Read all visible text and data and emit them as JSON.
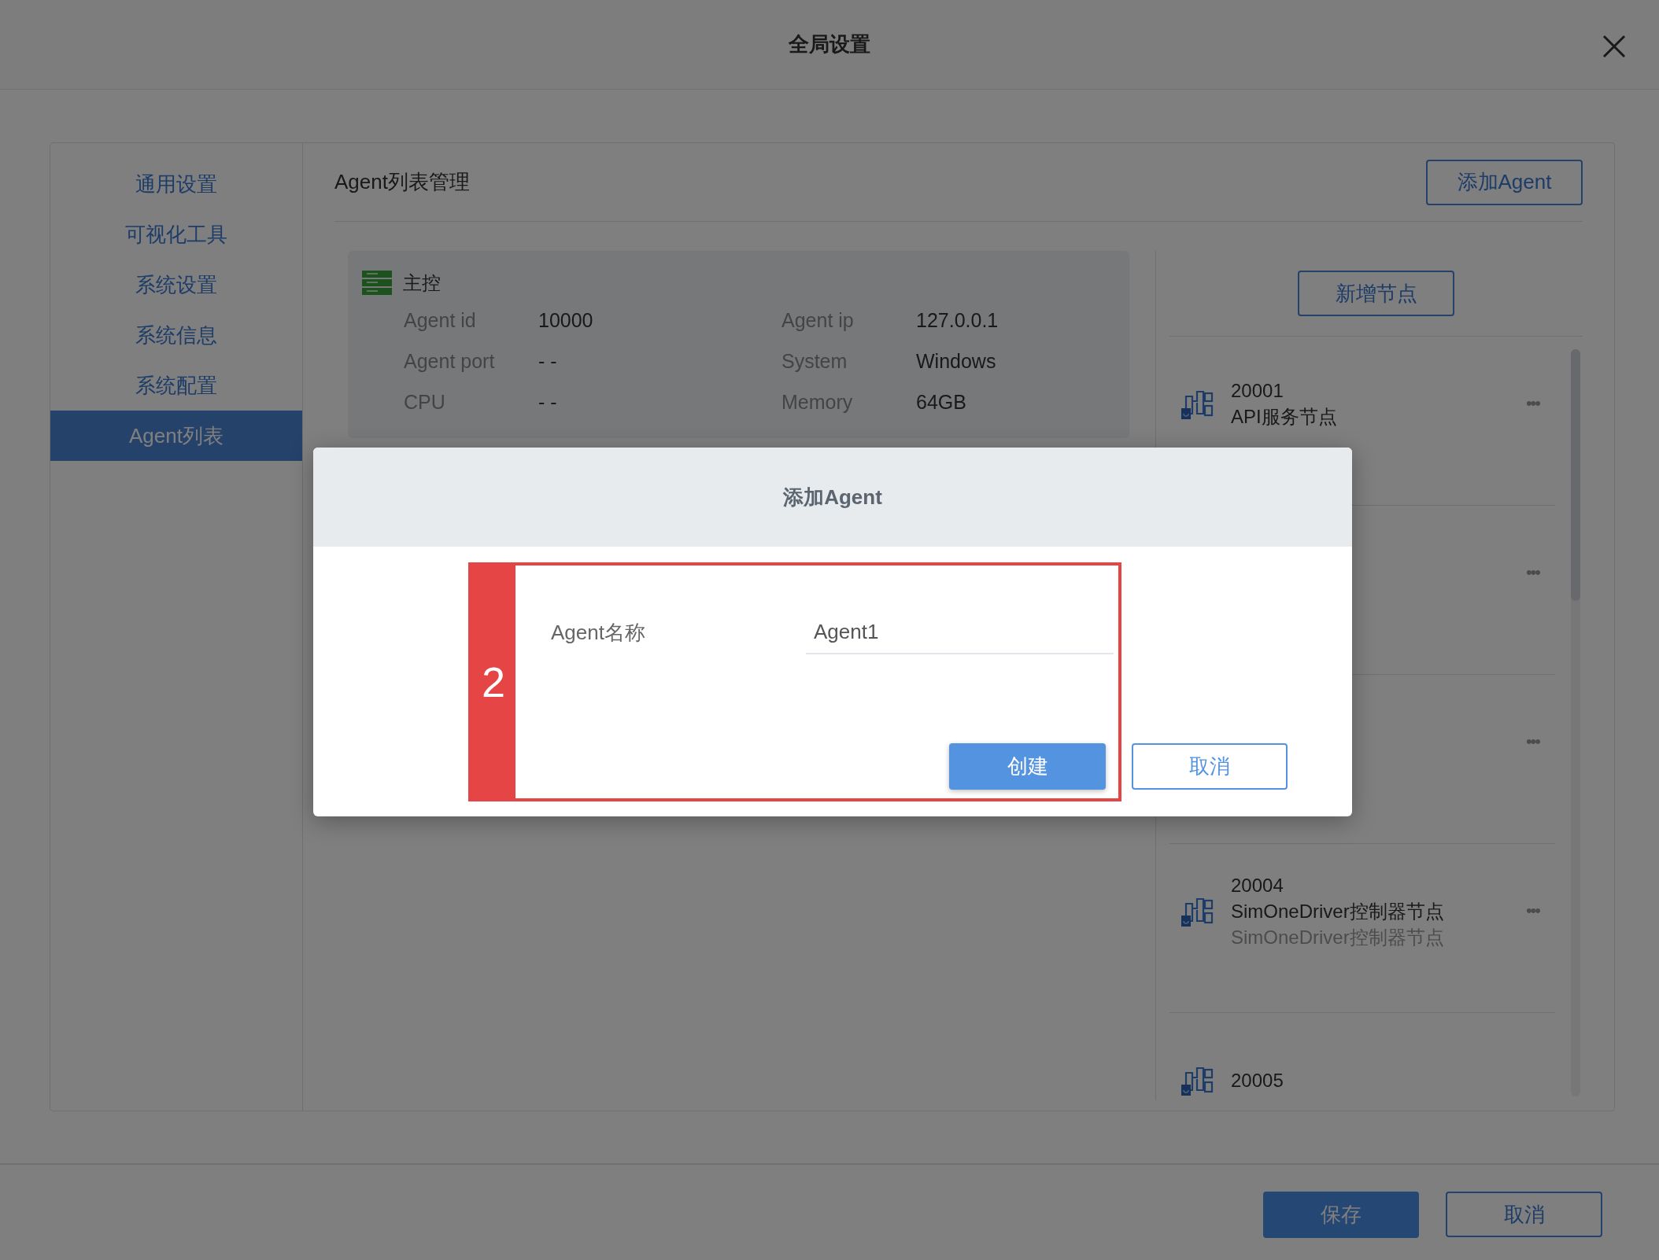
{
  "window": {
    "title": "全局设置"
  },
  "sidebar": {
    "items": [
      {
        "label": "通用设置",
        "selected": false
      },
      {
        "label": "可视化工具",
        "selected": false
      },
      {
        "label": "系统设置",
        "selected": false
      },
      {
        "label": "系统信息",
        "selected": false
      },
      {
        "label": "系统配置",
        "selected": false
      },
      {
        "label": "Agent列表",
        "selected": true
      }
    ]
  },
  "content": {
    "title": "Agent列表管理",
    "add_button": "添加Agent"
  },
  "master_card": {
    "title": "主控",
    "fields": [
      {
        "label": "Agent id",
        "value": "10000"
      },
      {
        "label": "Agent ip",
        "value": "127.0.0.1"
      },
      {
        "label": "Agent port",
        "value": "- -"
      },
      {
        "label": "System",
        "value": "Windows"
      },
      {
        "label": "CPU",
        "value": "- -"
      },
      {
        "label": "Memory",
        "value": "64GB"
      }
    ]
  },
  "nodes": {
    "add_button": "新增节点",
    "items": [
      {
        "code": "20001",
        "name": "API服务节点",
        "menu": "•••"
      },
      {
        "menu": "•••"
      },
      {
        "menu": "•••"
      },
      {
        "code": "20004",
        "name": "SimOneDriver控制器节点",
        "subtitle": "SimOneDriver控制器节点",
        "menu": "•••"
      },
      {
        "code": "20005"
      }
    ]
  },
  "footer": {
    "buttons": [
      {
        "label": "保存",
        "kind": "primary"
      },
      {
        "label": "取消",
        "kind": "secondary"
      }
    ]
  },
  "dialog": {
    "title": "添加Agent",
    "annotation": "2",
    "field": {
      "label": "Agent名称",
      "value": "Agent1"
    },
    "buttons": [
      {
        "label": "创建",
        "kind": "primary"
      },
      {
        "label": "取消",
        "kind": "secondary"
      }
    ]
  }
}
